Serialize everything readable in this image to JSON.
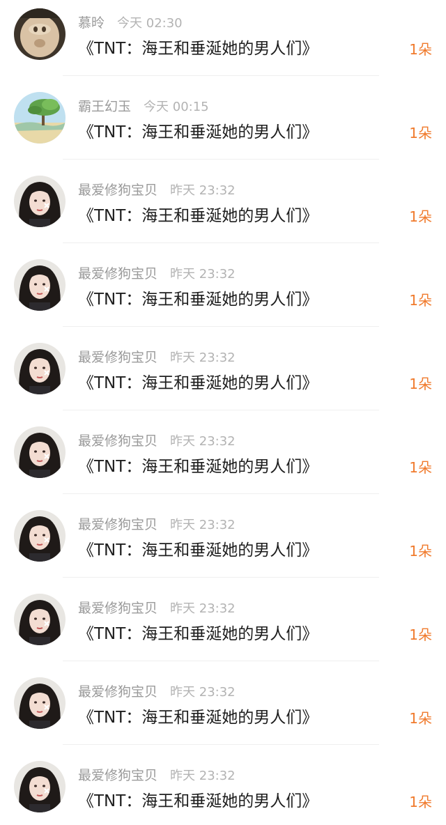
{
  "items": [
    {
      "user": "慕昤",
      "time": "今天 02:30",
      "message": "《TNT：海王和垂涎她的男人们》",
      "count": "1朵",
      "avatar": "pig-face-avatar-icon"
    },
    {
      "user": "霸王幻玉",
      "time": "今天 00:15",
      "message": "《TNT：海王和垂涎她的男人们》",
      "count": "1朵",
      "avatar": "landscape-tree-avatar-icon"
    },
    {
      "user": "最爱修狗宝贝",
      "time": "昨天 23:32",
      "message": "《TNT：海王和垂涎她的男人们》",
      "count": "1朵",
      "avatar": "girl-portrait-avatar-icon"
    },
    {
      "user": "最爱修狗宝贝",
      "time": "昨天 23:32",
      "message": "《TNT：海王和垂涎她的男人们》",
      "count": "1朵",
      "avatar": "girl-portrait-avatar-icon"
    },
    {
      "user": "最爱修狗宝贝",
      "time": "昨天 23:32",
      "message": "《TNT：海王和垂涎她的男人们》",
      "count": "1朵",
      "avatar": "girl-portrait-avatar-icon"
    },
    {
      "user": "最爱修狗宝贝",
      "time": "昨天 23:32",
      "message": "《TNT：海王和垂涎她的男人们》",
      "count": "1朵",
      "avatar": "girl-portrait-avatar-icon"
    },
    {
      "user": "最爱修狗宝贝",
      "time": "昨天 23:32",
      "message": "《TNT：海王和垂涎她的男人们》",
      "count": "1朵",
      "avatar": "girl-portrait-avatar-icon"
    },
    {
      "user": "最爱修狗宝贝",
      "time": "昨天 23:32",
      "message": "《TNT：海王和垂涎她的男人们》",
      "count": "1朵",
      "avatar": "girl-portrait-avatar-icon"
    },
    {
      "user": "最爱修狗宝贝",
      "time": "昨天 23:32",
      "message": "《TNT：海王和垂涎她的男人们》",
      "count": "1朵",
      "avatar": "girl-portrait-avatar-icon"
    },
    {
      "user": "最爱修狗宝贝",
      "time": "昨天 23:32",
      "message": "《TNT：海王和垂涎她的男人们》",
      "count": "1朵",
      "avatar": "girl-portrait-avatar-icon"
    }
  ]
}
